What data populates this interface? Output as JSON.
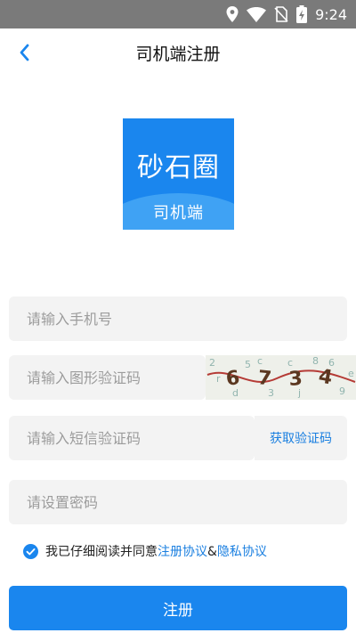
{
  "status_bar": {
    "time": "9:24",
    "icons": [
      "location-icon",
      "wifi-icon",
      "no-sim-icon",
      "battery-charging-icon"
    ]
  },
  "header": {
    "title": "司机端注册",
    "back_icon": "chevron-left-icon"
  },
  "logo": {
    "main_text": "砂石圈",
    "sub_text": "司机端"
  },
  "form": {
    "phone_placeholder": "请输入手机号",
    "captcha_placeholder": "请输入图形验证码",
    "captcha_text": "6734",
    "sms_placeholder": "请输入短信验证码",
    "sms_button": "获取验证码",
    "password_placeholder": "请设置密码"
  },
  "agreement": {
    "checked": true,
    "prefix": "我已仔细阅读并同意",
    "terms_link": "注册协议",
    "separator": "&",
    "privacy_link": "隐私协议"
  },
  "submit_label": "注册",
  "colors": {
    "accent": "#1a86ee",
    "status_bar": "#7a7a7a",
    "field_bg": "#f3f3f3",
    "link": "#1a7fe0"
  }
}
